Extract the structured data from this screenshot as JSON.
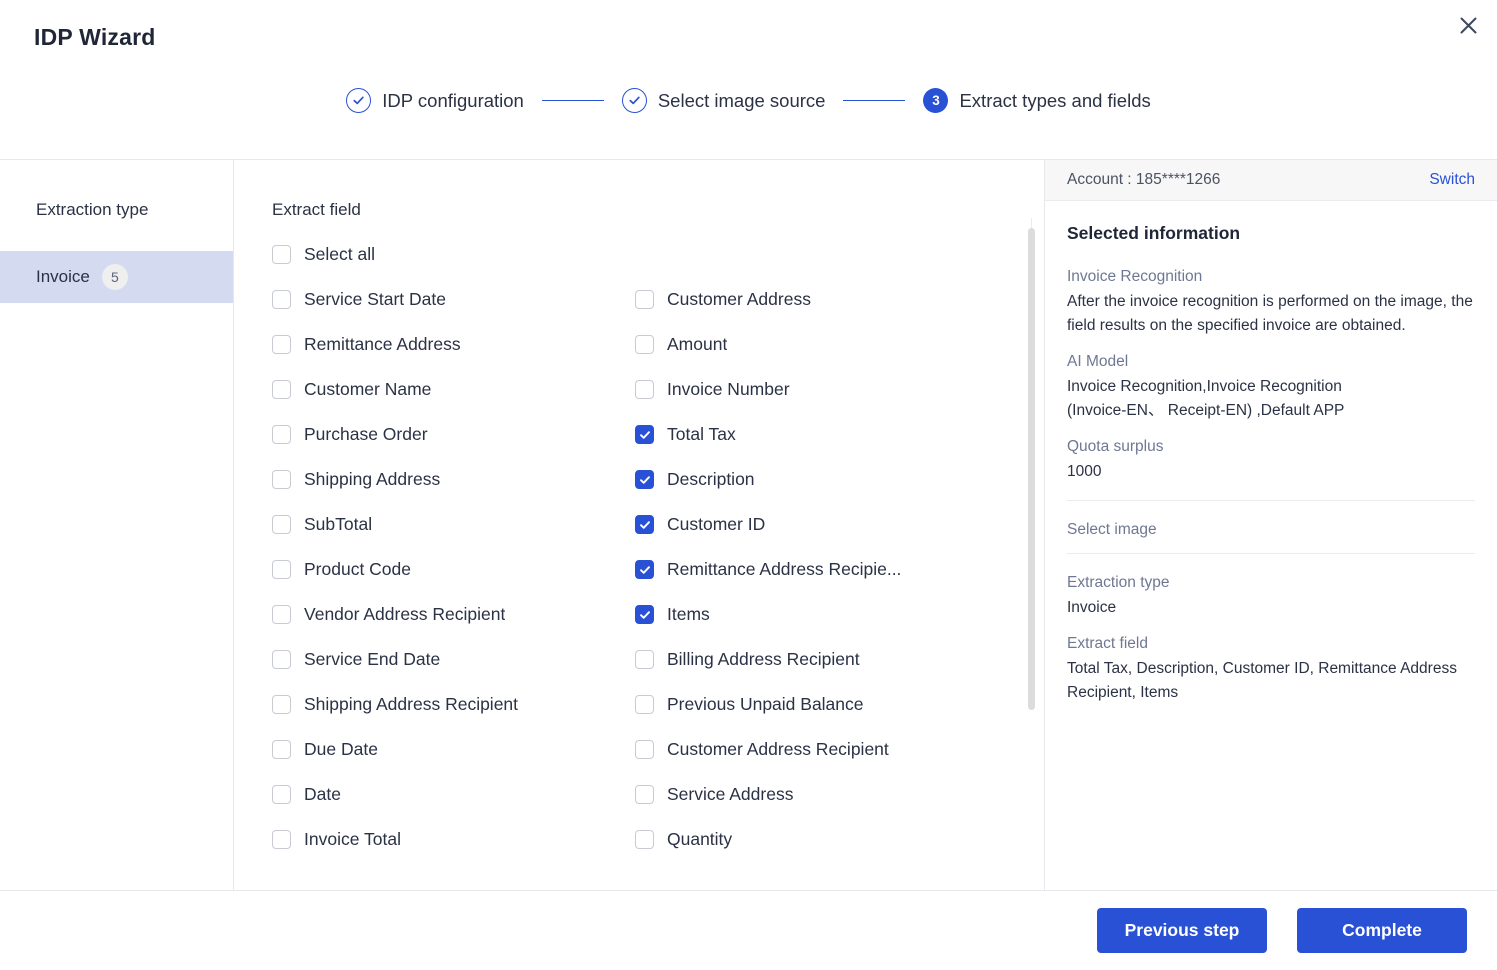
{
  "window": {
    "title": "IDP Wizard",
    "close_icon": "close-icon"
  },
  "stepper": {
    "steps": [
      {
        "label": "IDP configuration",
        "state": "done",
        "marker": "✓"
      },
      {
        "label": "Select image source",
        "state": "done",
        "marker": "✓"
      },
      {
        "label": "Extract types and fields",
        "state": "active",
        "marker": "3"
      }
    ]
  },
  "sidebar": {
    "header": "Extraction type",
    "items": [
      {
        "label": "Invoice",
        "badge": "5",
        "selected": true
      }
    ]
  },
  "fields": {
    "header": "Extract field",
    "select_all": {
      "label": "Select all",
      "checked": false
    },
    "rows": [
      {
        "left": {
          "label": "Service Start Date",
          "checked": false
        },
        "right": {
          "label": "Customer Address",
          "checked": false
        }
      },
      {
        "left": {
          "label": "Remittance Address",
          "checked": false
        },
        "right": {
          "label": "Amount",
          "checked": false
        }
      },
      {
        "left": {
          "label": "Customer Name",
          "checked": false
        },
        "right": {
          "label": "Invoice Number",
          "checked": false
        }
      },
      {
        "left": {
          "label": "Purchase Order",
          "checked": false
        },
        "right": {
          "label": "Total Tax",
          "checked": true
        }
      },
      {
        "left": {
          "label": "Shipping Address",
          "checked": false
        },
        "right": {
          "label": "Description",
          "checked": true
        }
      },
      {
        "left": {
          "label": "SubTotal",
          "checked": false
        },
        "right": {
          "label": "Customer ID",
          "checked": true
        }
      },
      {
        "left": {
          "label": "Product Code",
          "checked": false
        },
        "right": {
          "label": "Remittance Address Recipie...",
          "checked": true
        }
      },
      {
        "left": {
          "label": "Vendor Address Recipient",
          "checked": false
        },
        "right": {
          "label": "Items",
          "checked": true
        }
      },
      {
        "left": {
          "label": "Service End Date",
          "checked": false
        },
        "right": {
          "label": "Billing Address Recipient",
          "checked": false
        }
      },
      {
        "left": {
          "label": "Shipping Address Recipient",
          "checked": false
        },
        "right": {
          "label": "Previous Unpaid Balance",
          "checked": false
        }
      },
      {
        "left": {
          "label": "Due Date",
          "checked": false
        },
        "right": {
          "label": "Customer Address Recipient",
          "checked": false
        }
      },
      {
        "left": {
          "label": "Date",
          "checked": false
        },
        "right": {
          "label": "Service Address",
          "checked": false
        }
      },
      {
        "left": {
          "label": "Invoice Total",
          "checked": false
        },
        "right": {
          "label": "Quantity",
          "checked": false
        }
      }
    ]
  },
  "info": {
    "account_label": "Account : 185****1266",
    "switch_label": "Switch",
    "panel_title": "Selected information",
    "recognition_key": "Invoice Recognition",
    "recognition_val": "After the invoice recognition is performed on the image, the field results on the specified invoice are obtained.",
    "ai_model_key": "AI Model",
    "ai_model_val": "Invoice Recognition,Invoice Recognition\n  (Invoice-EN、 Receipt-EN) ,Default APP",
    "quota_key": "Quota surplus",
    "quota_val": "1000",
    "select_image_key": "Select image",
    "extraction_type_key": "Extraction type",
    "extraction_type_val": "Invoice",
    "extract_field_key": "Extract field",
    "extract_field_val": "Total Tax, Description, Customer ID, Remittance Address Recipient, Items"
  },
  "footer": {
    "previous_label": "Previous step",
    "complete_label": "Complete"
  },
  "colors": {
    "accent": "#2951d6",
    "sidebar_selected": "#d4daf0",
    "muted_text": "#6f7893"
  }
}
